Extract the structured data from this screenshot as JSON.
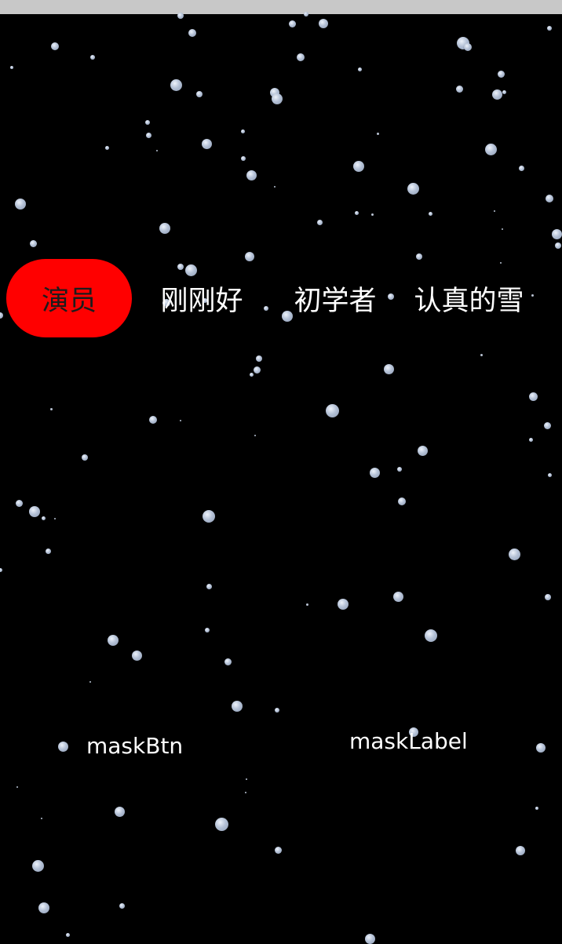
{
  "tabs": [
    {
      "label": "演员",
      "selected": true
    },
    {
      "label": "刚刚好",
      "selected": false
    },
    {
      "label": "初学者",
      "selected": false
    },
    {
      "label": "认真的雪",
      "selected": false
    }
  ],
  "mask_button": {
    "label": "maskBtn"
  },
  "mask_label": {
    "text": "maskLabel"
  },
  "colors": {
    "background": "#000000",
    "selected_tab": "#ff0000",
    "status_strip": "#c8c8c8",
    "snowflake": "#b4c1d6"
  }
}
